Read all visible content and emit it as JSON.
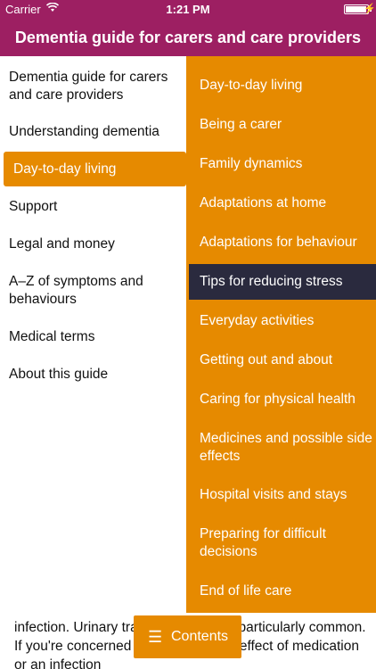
{
  "status_bar": {
    "carrier": "Carrier",
    "wifi_icon": "wifi-icon",
    "time": "1:21 PM",
    "battery_level": 0.95,
    "charging_icon": "bolt-icon"
  },
  "header": {
    "title": "Dementia guide for carers and care providers"
  },
  "left_menu": {
    "items": [
      {
        "label": "Dementia guide for carers and care providers"
      },
      {
        "label": "Understanding dementia"
      },
      {
        "label": "Day-to-day living",
        "selected": true
      },
      {
        "label": "Support"
      },
      {
        "label": "Legal and money"
      },
      {
        "label": "A–Z of symptoms and behaviours"
      },
      {
        "label": "Medical terms"
      },
      {
        "label": "About this guide"
      }
    ]
  },
  "right_menu": {
    "items": [
      {
        "label": "Day-to-day living"
      },
      {
        "label": "Being a carer"
      },
      {
        "label": "Family dynamics"
      },
      {
        "label": "Adaptations at home"
      },
      {
        "label": "Adaptations for behaviour"
      },
      {
        "label": "Tips for reducing stress",
        "selected": true
      },
      {
        "label": "Everyday activities"
      },
      {
        "label": "Getting out and about"
      },
      {
        "label": "Caring for physical health"
      },
      {
        "label": "Medicines and possible side effects"
      },
      {
        "label": "Hospital visits and stays"
      },
      {
        "label": "Preparing for difficult decisions"
      },
      {
        "label": "End of life care"
      }
    ]
  },
  "content": {
    "text": "infection. Urinary tract infections are particularly common. If you're concerned about a possible effect of medication or an infection"
  },
  "contents_button": {
    "label": "Contents",
    "icon": "list-icon"
  },
  "colors": {
    "header": "#9d1f62",
    "accent": "#e68a00",
    "selected_dark": "#2a2a3e"
  }
}
